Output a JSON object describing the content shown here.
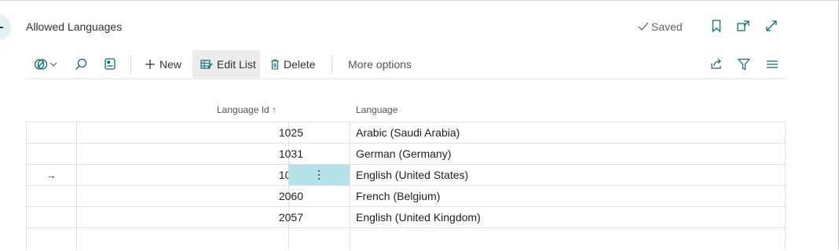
{
  "header": {
    "title": "Allowed Languages",
    "saved_label": "Saved"
  },
  "toolbar": {
    "new_label": "New",
    "edit_list_label": "Edit List",
    "delete_label": "Delete",
    "more_options_label": "More options"
  },
  "table": {
    "columns": {
      "language_id": "Language Id ↑",
      "language": "Language"
    },
    "rows": [
      {
        "id": "1025",
        "language": "Arabic (Saudi Arabia)",
        "selected": false,
        "arrow": ""
      },
      {
        "id": "1031",
        "language": "German (Germany)",
        "selected": false,
        "arrow": ""
      },
      {
        "id": "1033",
        "language": "English (United States)",
        "selected": true,
        "arrow": "→"
      },
      {
        "id": "2060",
        "language": "French (Belgium)",
        "selected": false,
        "arrow": ""
      },
      {
        "id": "2057",
        "language": "English (United Kingdom)",
        "selected": false,
        "arrow": ""
      },
      {
        "id": "",
        "language": "",
        "selected": false,
        "arrow": ""
      }
    ]
  },
  "colors": {
    "accent": "#00a0b0",
    "selected_cell": "#b6e3ea",
    "back_button": "#e3f1f3"
  },
  "icons": [
    "back-icon",
    "check-icon",
    "bookmark-icon",
    "open-new-window-icon",
    "expand-icon",
    "analyze-icon",
    "chevron-down-icon",
    "search-icon",
    "filter-pane-icon",
    "plus-icon",
    "edit-list-icon",
    "trash-icon",
    "share-icon",
    "filter-icon",
    "list-view-icon",
    "more-dots-icon"
  ]
}
